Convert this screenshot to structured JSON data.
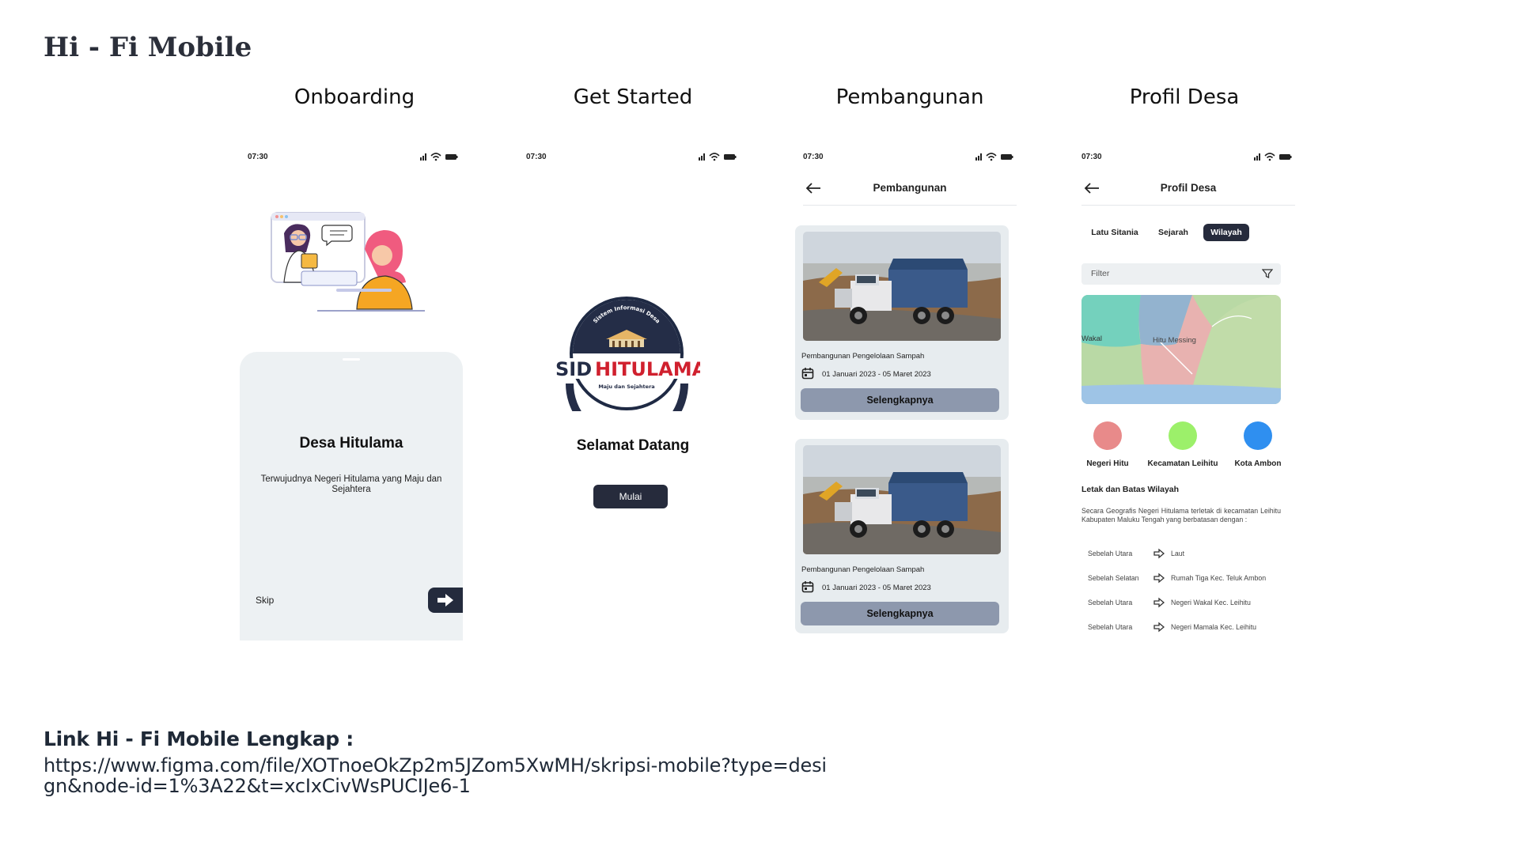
{
  "slide": {
    "title": "Hi - Fi Mobile"
  },
  "columns": [
    "Onboarding",
    "Get Started",
    "Pembangunan",
    "Profil Desa"
  ],
  "status": {
    "time": "07:30"
  },
  "onboarding": {
    "title": "Desa Hitulama",
    "subtitle": "Terwujudnya Negeri Hitulama yang Maju dan Sejahtera",
    "skip": "Skip"
  },
  "get_started": {
    "logo_main_a": "SID",
    "logo_main_b": "HITULAMA",
    "logo_arc": "Sistem Informasi Desa",
    "logo_tagline": "Maju dan Sejahtera",
    "welcome": "Selamat Datang",
    "button": "Mulai"
  },
  "pembangunan": {
    "title": "Pembangunan",
    "cards": [
      {
        "title": "Pembangunan Pengelolaan Sampah",
        "date": "01 Januari 2023 - 05 Maret 2023",
        "button": "Selengkapnya"
      },
      {
        "title": "Pembangunan Pengelolaan Sampah",
        "date": "01 Januari 2023 - 05 Maret 2023",
        "button": "Selengkapnya"
      }
    ]
  },
  "profil": {
    "title": "Profil Desa",
    "tabs": [
      "Latu Sitania",
      "Sejarah",
      "Wilayah"
    ],
    "active_tab": "Wilayah",
    "filter_placeholder": "Filter",
    "map_labels": [
      "Wakal",
      "Hitu Messing"
    ],
    "legend": [
      {
        "label": "Negeri Hitu",
        "color": "#e88a8a"
      },
      {
        "label": "Kecamatan Leihitu",
        "color": "#9cf06a"
      },
      {
        "label": "Kota Ambon",
        "color": "#2f8ff0"
      }
    ],
    "section_title": "Letak dan Batas Wilayah",
    "section_text": "Secara Geografis Negeri Hitulama terletak di kecamatan Leihitu Kabupaten Maluku Tengah yang berbatasan dengan :",
    "borders": [
      {
        "side": "Sebelah Utara",
        "value": "Laut"
      },
      {
        "side": "Sebelah Selatan",
        "value": "Rumah Tiga Kec. Teluk Ambon"
      },
      {
        "side": "Sebelah Utara",
        "value": "Negeri Wakal Kec. Leihitu"
      },
      {
        "side": "Sebelah Utara",
        "value": "Negeri Mamala Kec. Leihitu"
      }
    ]
  },
  "link": {
    "label": "Link Hi - Fi Mobile Lengkap :",
    "url": "https://www.figma.com/file/XOTnoeOkZp2m5JZom5XwMH/skripsi-mobile?type=design&node-id=1%3A22&t=xcIxCivWsPUCIJe6-1"
  }
}
